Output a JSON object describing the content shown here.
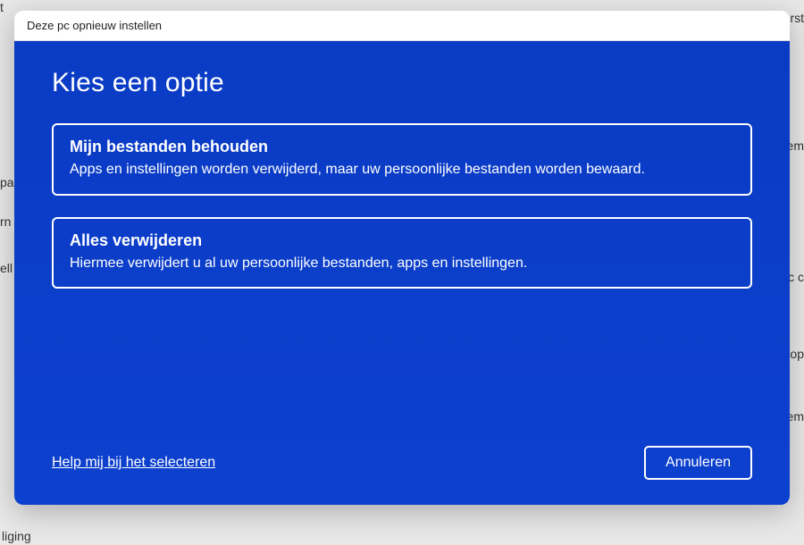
{
  "background": {
    "fragment1": "erst",
    "fragment2": "eem",
    "fragment3": "pa",
    "fragment4": "rn",
    "fragment5": "ell",
    "fragment6": "Pc c",
    "fragment7": "n op",
    "fragment8": "eem",
    "fragment9": "liging",
    "fragment10": "t"
  },
  "dialog": {
    "title": "Deze pc opnieuw instellen",
    "heading": "Kies een optie",
    "options": [
      {
        "title": "Mijn bestanden behouden",
        "description": "Apps en instellingen worden verwijderd, maar uw persoonlijke bestanden worden bewaard."
      },
      {
        "title": "Alles verwijderen",
        "description": "Hiermee verwijdert u al uw persoonlijke bestanden, apps en instellingen."
      }
    ],
    "help_link": "Help mij bij het selecteren",
    "cancel_button": "Annuleren"
  }
}
